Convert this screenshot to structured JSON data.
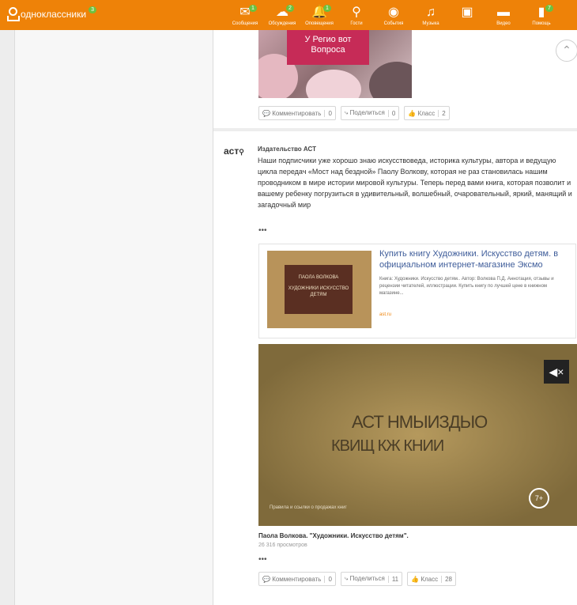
{
  "topbar": {
    "logo": "одноклассники",
    "logo_badge": "3",
    "nav": [
      {
        "label": "Сообщения",
        "icon": "envelope-icon",
        "glyph": "✉",
        "badge": "1"
      },
      {
        "label": "Обсуждения",
        "icon": "chat-icon",
        "glyph": "☁",
        "badge": "2"
      },
      {
        "label": "Оповещения",
        "icon": "bell-icon",
        "glyph": "🔔",
        "badge": "1"
      },
      {
        "label": "Гости",
        "icon": "footprints-icon",
        "glyph": "⚲",
        "badge": ""
      },
      {
        "label": "События",
        "icon": "events-icon",
        "glyph": "◉",
        "badge": ""
      },
      {
        "label": "Музыка",
        "icon": "music-icon",
        "glyph": "♫",
        "badge": ""
      },
      {
        "label": "",
        "icon": "media-icon",
        "glyph": "▣",
        "badge": ""
      },
      {
        "label": "Видео",
        "icon": "video-icon",
        "glyph": "▬",
        "badge": ""
      },
      {
        "label": "Помощь",
        "icon": "help-icon",
        "glyph": "▮",
        "badge": "7"
      }
    ]
  },
  "post1": {
    "image_text": "У Регио вот Вопроса",
    "comment_label": "Комментировать",
    "comment_count": "0",
    "share_label": "Поделиться",
    "share_count": "0",
    "like_label": "Класс",
    "like_count": "2"
  },
  "post2": {
    "author": "Издательство АСТ",
    "avatar_text": "аст",
    "text": "Наши подписчики уже хорошо знаю искусствоведа, историка культуры, автора и ведущую цикла передач «Мост над бездной» Паолу Волкову, которая не раз становилась нашим проводником в мире истории мировой культуры. Теперь перед вами книга, которая позволит и вашему ребенку погрузиться в удивительный, волшебный, очаровательный, яркий, манящий и загадочный мир",
    "more": "•••",
    "link": {
      "title": "Купить книгу Художники. Искусство детям. в официальном интернет-магазине Эксмо",
      "description": "Книга: Художники. Искусство детям.. Автор: Волкова П.Д. Аннотация, отзывы и рецензии читателей, иллюстрации. Купить книгу по лучшей цене в книжном магазине...",
      "source": "ast.ru",
      "book_author": "ПАОЛА ВОЛКОВА",
      "book_title": "ХУДОЖНИКИ ИСКУССТВО ДЕТЯМ"
    },
    "video": {
      "line1": "АСТ НМЫИЗДЫО",
      "line2": "КВИЩ КЖ КНИИ",
      "age": "7+",
      "caption": "Правила и ссылки о продажах книг",
      "mute_glyph": "◀×"
    },
    "video_title": "Паола Волкова. \"Художники. Искусство детям\".",
    "views": "26 316 просмотров",
    "more2": "•••",
    "comment_label": "Комментировать",
    "comment_count": "0",
    "share_label": "Поделиться",
    "share_count": "11",
    "like_label": "Класс",
    "like_count": "28"
  },
  "scroll_up": "⌃"
}
